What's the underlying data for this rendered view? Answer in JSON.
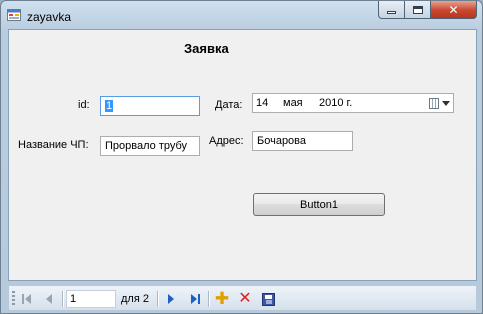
{
  "window": {
    "title": "zayavka"
  },
  "form": {
    "heading": "Заявка",
    "id_label": "id:",
    "id_value": "1",
    "date_label": "Дата:",
    "date_day": "14",
    "date_month": "мая",
    "date_year": "2010 г.",
    "name_label": "Название ЧП:",
    "name_value": "Прорвало трубу",
    "address_label": "Адрес:",
    "address_value": "Бочарова",
    "button_label": "Button1"
  },
  "navigator": {
    "position": "1",
    "count_label": "для 2"
  },
  "icons": {
    "first": "move-first-icon",
    "prev": "move-previous-icon",
    "next": "move-next-icon",
    "last": "move-last-icon",
    "add": "add-new-icon",
    "delete": "delete-icon",
    "save": "save-icon"
  },
  "colors": {
    "selection": "#3399ff",
    "close_button": "#c8472f",
    "nav_accent": "#1f5fbf"
  }
}
